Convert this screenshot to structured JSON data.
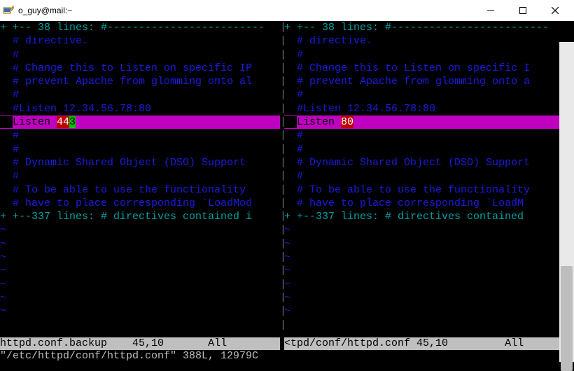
{
  "window": {
    "title": "o_guy@mail:~"
  },
  "fold_top": {
    "left": "+ +-- 38 lines: #-------------------------",
    "right": "+ +-- 38 lines: #-------------------------"
  },
  "body_lines": {
    "l1": "# directive.",
    "l2": "#",
    "l3": "# Change this to Listen on specific IP",
    "r3": "# Change this to Listen on specific I",
    "l4": "# prevent Apache from glomming onto al",
    "r4": "# prevent Apache from glomming onto a",
    "l5": "#",
    "l6": "#Listen 12.34.56.78:80",
    "l8": "#",
    "l9_left": "# Dynamic Shared Object (DSO) Support",
    "l9_right": "# Dynamic Shared Object (DSO) Support",
    "l10": "#",
    "l11": "# To be able to use the functionality",
    "l12_left": "# have to place corresponding `LoadMod",
    "l12_right": "# have to place corresponding `LoadM"
  },
  "listen": {
    "left_prefix": "Listen ",
    "left_same": "44",
    "left_extra": "3",
    "right_prefix": "Listen ",
    "right_val": "80"
  },
  "fold_bot": {
    "left": "+ +--337 lines: # directives contained i",
    "right": "+ +--337 lines: # directives contained "
  },
  "tilde": "~",
  "status": {
    "left_name": "httpd.conf.backup",
    "left_pos": "45,10",
    "left_pct": "All",
    "right_name": "<tpd/conf/httpd.conf",
    "right_pos": "45,10",
    "right_pct": "All"
  },
  "cmd": "\"/etc/httpd/conf/httpd.conf\" 388L, 12979C"
}
